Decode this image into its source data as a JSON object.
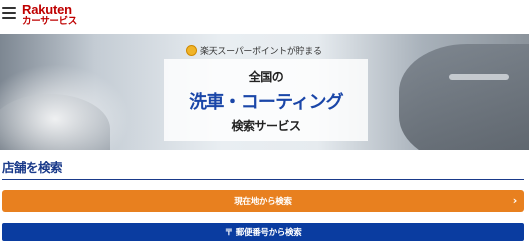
{
  "header": {
    "brand": "Rakuten",
    "service": "カーサービス"
  },
  "hero": {
    "points_text": "楽天スーパーポイントが貯まる",
    "line1": "全国の",
    "line2": "洗車・コーティング",
    "line3": "検索サービス"
  },
  "search": {
    "title": "店舗を検索",
    "location_button": "現在地から検索",
    "postal_mark": "〒",
    "postal_button": "郵便番号から検索"
  },
  "colors": {
    "brand_red": "#bf0000",
    "title_blue": "#1a3a8a",
    "orange": "#e8801f",
    "navy": "#0a3ca0"
  }
}
